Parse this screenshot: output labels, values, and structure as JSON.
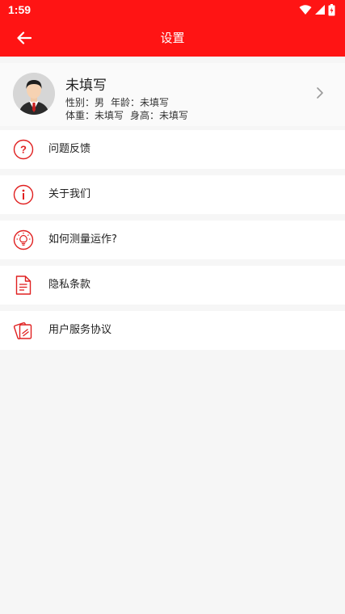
{
  "status_bar": {
    "time": "1:59",
    "icons": [
      "wifi-icon",
      "cell-signal-icon",
      "battery-icon"
    ]
  },
  "app_bar": {
    "title": "设置",
    "back_icon": "arrow-left-icon"
  },
  "profile": {
    "name": "未填写",
    "gender_label": "性别：",
    "gender_value": "男",
    "age_label": "年龄：",
    "age_value": "未填写",
    "weight_label": "体重：",
    "weight_value": "未填写",
    "height_label": "身高：",
    "height_value": "未填写"
  },
  "menu": [
    {
      "label": "问题反馈",
      "icon": "question-circle-icon"
    },
    {
      "label": "关于我们",
      "icon": "info-circle-icon"
    },
    {
      "label": "如何测量运作?",
      "icon": "lightbulb-icon"
    },
    {
      "label": "隐私条款",
      "icon": "document-icon"
    },
    {
      "label": "用户服务协议",
      "icon": "agreement-cards-icon"
    }
  ],
  "colors": {
    "accent": "#ff1414",
    "icon": "#e02020",
    "background": "#f6f6f6"
  }
}
